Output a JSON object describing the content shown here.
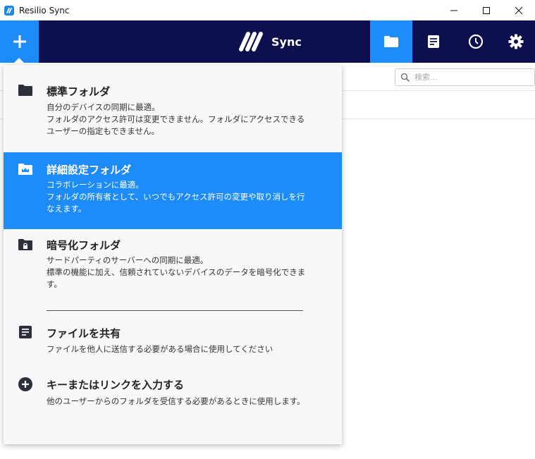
{
  "window": {
    "title": "Resilio Sync"
  },
  "appbar": {
    "logo_text": "Sync",
    "accent_color": "#1d8cf8",
    "background_color": "#0d0f4f",
    "nav": [
      {
        "name": "folders",
        "icon": "folder-icon",
        "active": true
      },
      {
        "name": "transfers",
        "icon": "document-icon",
        "active": false
      },
      {
        "name": "history",
        "icon": "clock-icon",
        "active": false
      },
      {
        "name": "settings",
        "icon": "gear-icon",
        "active": false
      }
    ]
  },
  "search": {
    "placeholder": "検索..."
  },
  "menu": {
    "items": [
      {
        "title": "標準フォルダ",
        "description": "自分のデバイスの同期に最適。\nフォルダのアクセス許可は変更できません。フォルダにアクセスできるユーザーの指定もできません。",
        "icon": "folder-icon",
        "highlighted": false
      },
      {
        "title": "詳細設定フォルダ",
        "description": "コラボレーションに最適。\nフォルダの所有者として、いつでもアクセス許可の変更や取り消しを行なえます。",
        "icon": "crown-folder-icon",
        "highlighted": true
      },
      {
        "title": "暗号化フォルダ",
        "description": "サードパーティのサーバーへの同期に最適。\n標準の機能に加え、信頼されていないデバイスのデータを暗号化できます。",
        "icon": "lock-folder-icon",
        "highlighted": false
      },
      {
        "title": "ファイルを共有",
        "description": "ファイルを他人に送信する必要がある場合に使用してください",
        "icon": "file-icon",
        "highlighted": false
      },
      {
        "title": "キーまたはリンクを入力する",
        "description": "他のユーザーからのフォルダを受信する必要があるときに使用します。",
        "icon": "plus-circle-icon",
        "highlighted": false
      }
    ]
  }
}
